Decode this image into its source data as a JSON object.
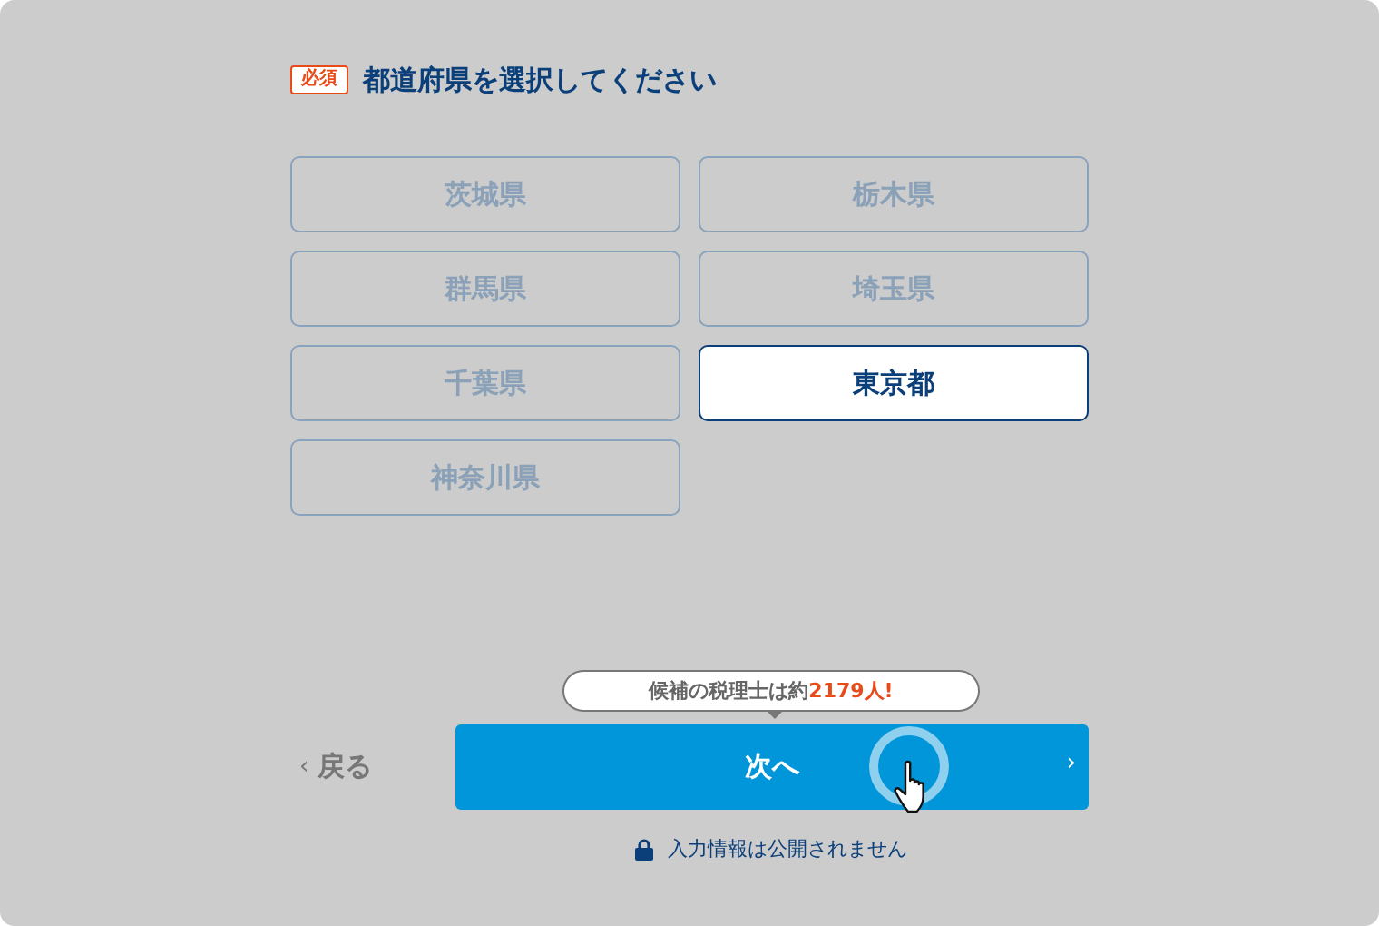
{
  "question": {
    "badge": "必須",
    "title": "都道府県を選択してください"
  },
  "options": [
    {
      "label": "茨城県",
      "selected": false
    },
    {
      "label": "栃木県",
      "selected": false
    },
    {
      "label": "群馬県",
      "selected": false
    },
    {
      "label": "埼玉県",
      "selected": false
    },
    {
      "label": "千葉県",
      "selected": false
    },
    {
      "label": "東京都",
      "selected": true
    },
    {
      "label": "神奈川県",
      "selected": false
    }
  ],
  "tooltip": "候補の税理士は約**2179人!**",
  "back_link": {
    "icon": "‹",
    "label": "戻る"
  },
  "next_button": {
    "label": "次へ",
    "icon": "›"
  },
  "privacy_note": "入力情報は公開されません"
}
